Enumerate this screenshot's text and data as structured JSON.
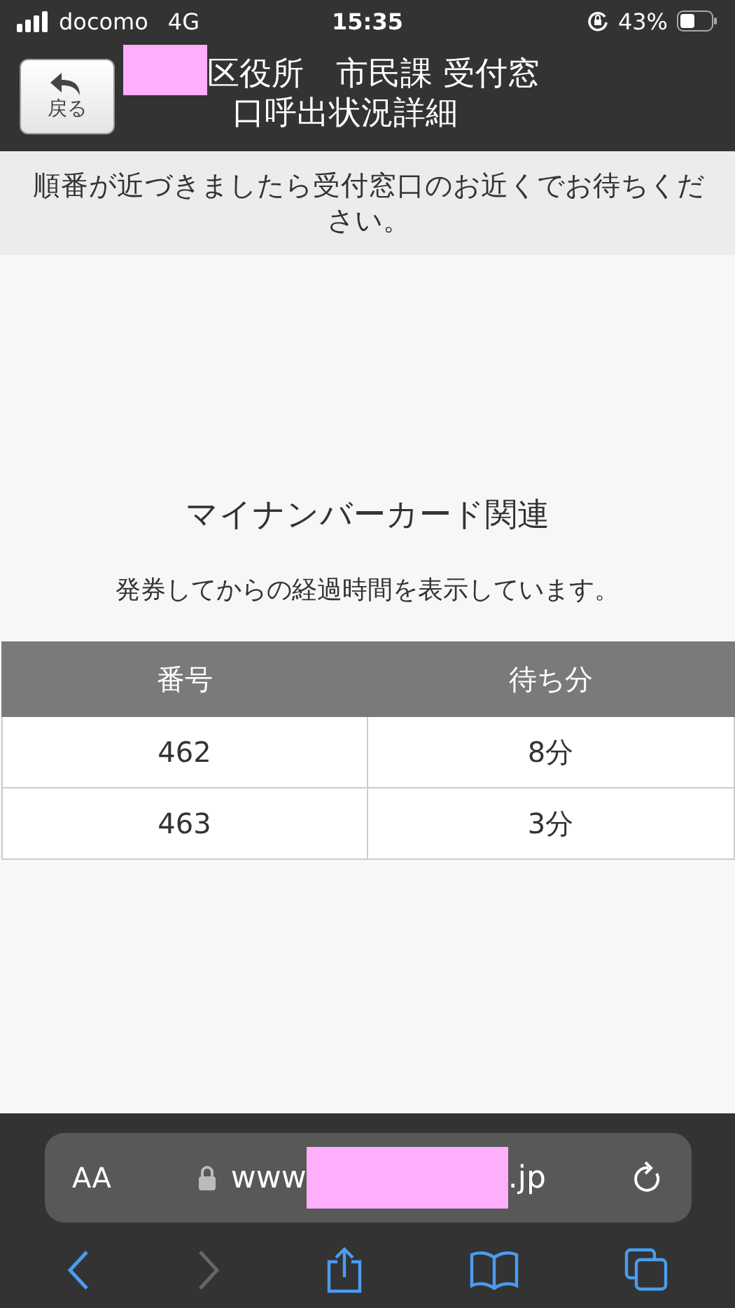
{
  "status_bar": {
    "carrier": "docomo",
    "network": "4G",
    "time": "15:35",
    "battery": "43%"
  },
  "header": {
    "back_button": "戻る",
    "title_line_1": "区役所　市民課 受付窓",
    "title_line_2": "口呼出状況詳細"
  },
  "notice": "順番が近づきましたら受付窓口のお近くでお待ちください。",
  "section": {
    "title": "マイナンバーカード関連",
    "description": "発券してからの経過時間を表示しています。"
  },
  "table": {
    "columns": [
      "番号",
      "待ち分"
    ],
    "rows": [
      [
        "462",
        "8分"
      ],
      [
        "463",
        "3分"
      ]
    ]
  },
  "browser_bar": {
    "text_size_button": "AA",
    "url_start": "www",
    "url_end": ".jp",
    "forward_disabled": true
  }
}
